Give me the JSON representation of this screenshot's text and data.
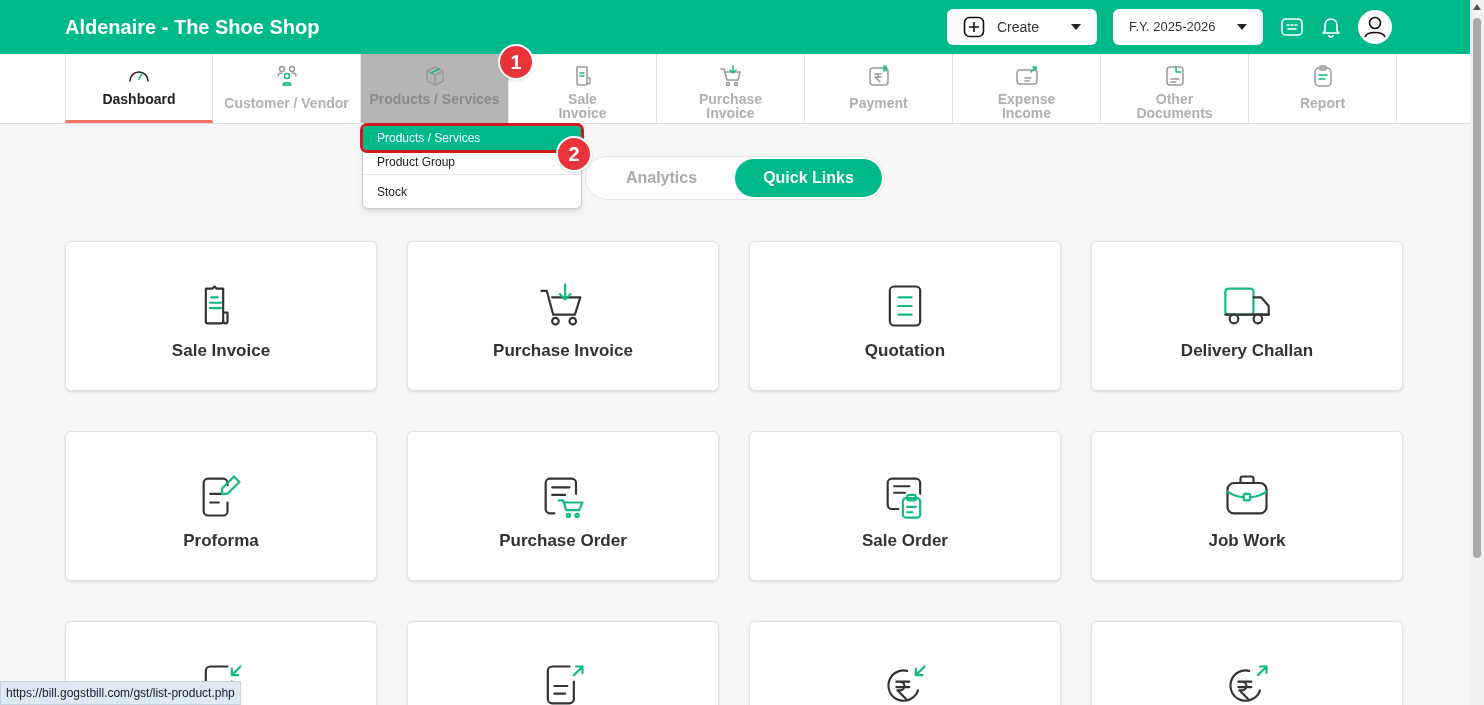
{
  "header": {
    "title": "Aldenaire - The Shoe Shop",
    "create_button": "Create",
    "year_select": "F.Y. 2025-2026"
  },
  "nav_tabs": [
    {
      "label": "Dashboard",
      "selected": true,
      "hovered": false
    },
    {
      "label": "Customer / Vendor",
      "selected": false,
      "hovered": false
    },
    {
      "label": "Products / Services",
      "selected": false,
      "hovered": true
    },
    {
      "label": "Sale\nInvoice",
      "selected": false,
      "hovered": false
    },
    {
      "label": "Purchase\nInvoice",
      "selected": false,
      "hovered": false
    },
    {
      "label": "Payment",
      "selected": false,
      "hovered": false
    },
    {
      "label": "Expense\nIncome",
      "selected": false,
      "hovered": false
    },
    {
      "label": "Other\nDocuments",
      "selected": false,
      "hovered": false
    },
    {
      "label": "Report",
      "selected": false,
      "hovered": false
    }
  ],
  "dropdown": {
    "items": [
      {
        "label": "Products / Services",
        "selected": true
      },
      {
        "label": "Product Group",
        "selected": false
      },
      {
        "label": "Stock",
        "selected": false
      }
    ]
  },
  "callouts": [
    "1",
    "2"
  ],
  "view_toggle": [
    {
      "label": "Analytics",
      "selected": false
    },
    {
      "label": "Quick Links",
      "selected": true
    }
  ],
  "cards": [
    {
      "kind": "full",
      "label": "Sale Invoice"
    },
    {
      "kind": "full",
      "label": "Purchase Invoice"
    },
    {
      "kind": "full",
      "label": "Quotation"
    },
    {
      "kind": "full",
      "label": "Delivery Challan"
    },
    {
      "kind": "full",
      "label": "Proforma"
    },
    {
      "kind": "full",
      "label": "Purchase Order"
    },
    {
      "kind": "full",
      "label": "Sale Order"
    },
    {
      "kind": "full",
      "label": "Job Work"
    },
    {
      "kind": "cut"
    },
    {
      "kind": "cut"
    },
    {
      "kind": "cut"
    },
    {
      "kind": "cut"
    }
  ],
  "status_link": "https://bill.gogstbill.com/gst/list-product.php"
}
